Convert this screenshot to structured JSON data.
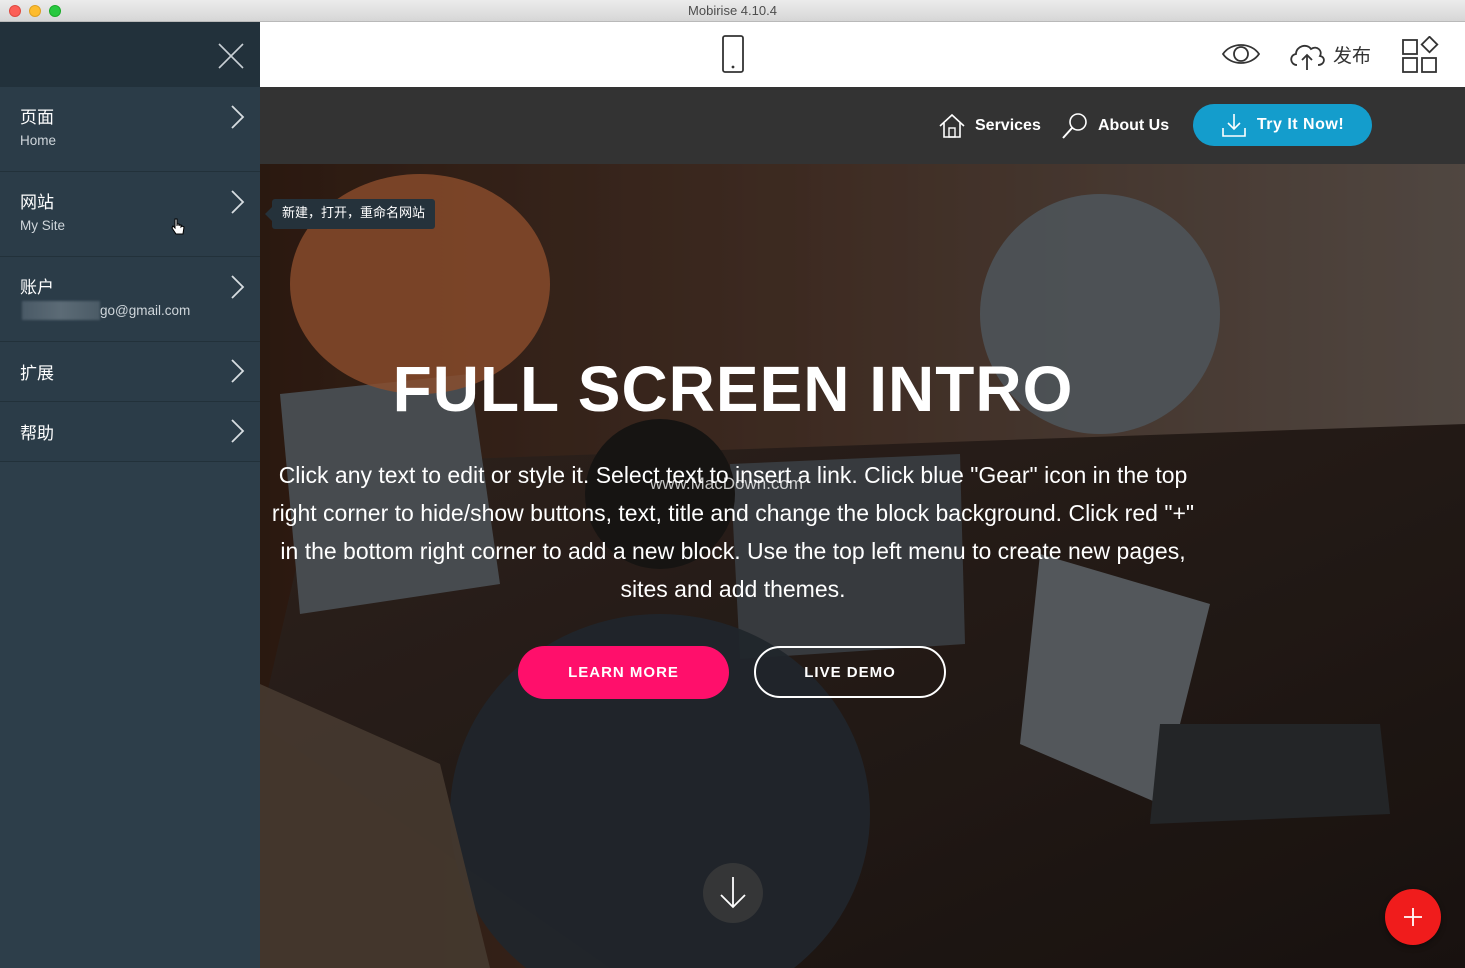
{
  "window": {
    "title": "Mobirise 4.10.4"
  },
  "sidebar": {
    "close_icon": "close-icon",
    "items": [
      {
        "title": "页面",
        "subtitle": "Home"
      },
      {
        "title": "网站",
        "subtitle": "My Site"
      },
      {
        "title": "账户",
        "subtitle": "go@gmail.com"
      },
      {
        "title": "扩展"
      },
      {
        "title": "帮助"
      }
    ]
  },
  "tooltip": {
    "text": "新建，打开，重命名网站"
  },
  "toolbar": {
    "publish_label": "发布",
    "icons": [
      "phone-icon",
      "eye-icon",
      "cloud-upload-icon",
      "blocks-icon"
    ]
  },
  "preview": {
    "nav": {
      "services_label": "Services",
      "about_label": "About Us",
      "try_label": "Try It Now!"
    },
    "hero": {
      "title": "FULL SCREEN INTRO",
      "text": "Click any text to edit or style it. Select text to insert a link. Click blue \"Gear\" icon in the top right corner to hide/show buttons, text, title and change the block background. Click red \"+\" in the bottom right corner to add a new block. Use the top left menu to create new pages, sites and add themes.",
      "watermark": "www.MacDown.com",
      "learn_more_label": "LEARN MORE",
      "live_demo_label": "LIVE DEMO"
    }
  },
  "colors": {
    "sidebar_bg": "#2d3e4a",
    "try_button": "#149dcc",
    "learn_more": "#ff0f6b",
    "add_button": "#f01c1c"
  }
}
